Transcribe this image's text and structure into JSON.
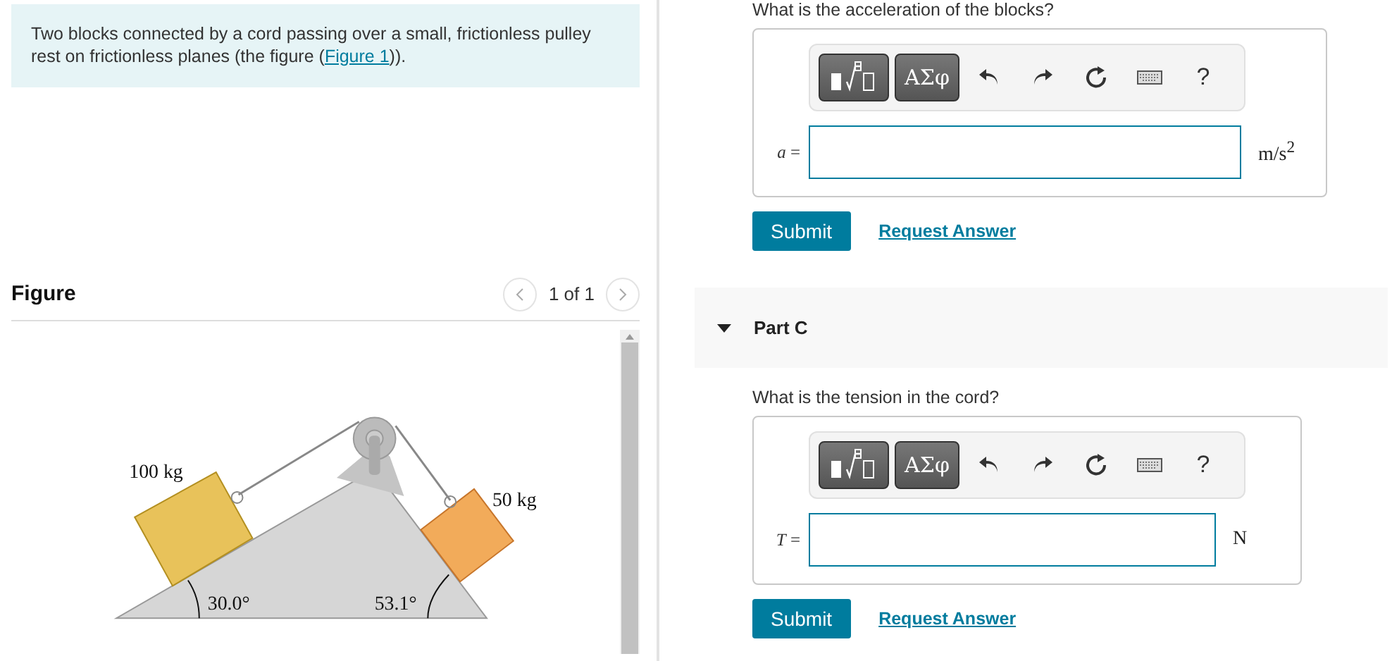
{
  "problem": {
    "text_before": "Two blocks connected by a cord passing over a small, frictionless pulley rest on frictionless planes (the figure (",
    "link": "Figure 1",
    "text_after": "))."
  },
  "figure": {
    "title": "Figure",
    "pager": "1 of 1",
    "labels": {
      "mass_left": "100 kg",
      "mass_right": "50 kg",
      "angle_left": "30.0°",
      "angle_right": "53.1°"
    }
  },
  "part_b": {
    "question": "What is the acceleration of the blocks?",
    "toolbar": {
      "symbols": "ΑΣφ",
      "help": "?"
    },
    "label": "*a* =",
    "unit": "m/s$^{2}$",
    "submit": "Submit",
    "request": "Request Answer"
  },
  "part_c": {
    "header": {
      "label": "Part C",
      "expanded": true
    },
    "question": "What is the tension in the cord?",
    "toolbar": {
      "symbols": "ΑΣφ",
      "help": "?"
    },
    "label": "*T* =",
    "unit": "N",
    "submit": "Submit",
    "request": "Request Answer"
  }
}
